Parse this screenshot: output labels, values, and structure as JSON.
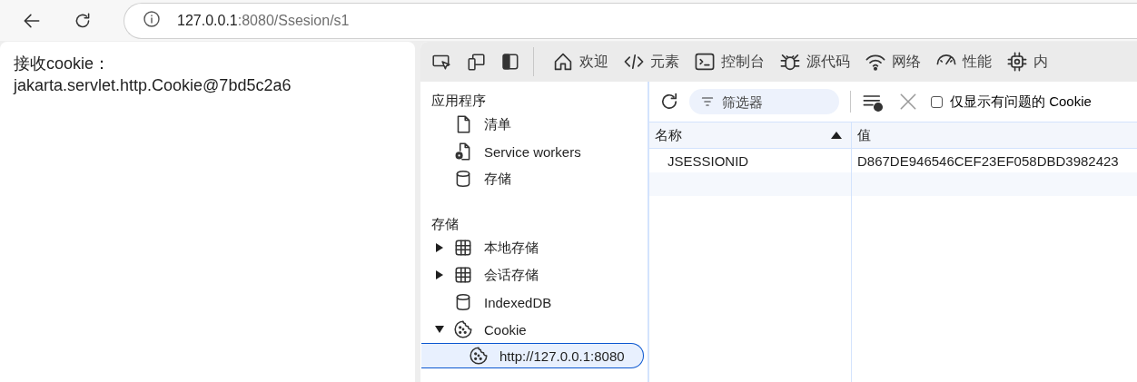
{
  "browser": {
    "address": {
      "host": "127.0.0.1",
      "path": ":8080/Ssesion/s1"
    }
  },
  "page": {
    "lines": [
      "接收cookie：",
      "jakarta.servlet.http.Cookie@7bd5c2a6"
    ]
  },
  "devtools": {
    "tools": [
      {
        "kind": "inspect"
      },
      {
        "kind": "device"
      },
      {
        "kind": "sidebar"
      }
    ],
    "tabs": [
      {
        "kind": "home",
        "label": "欢迎",
        "selected": false
      },
      {
        "kind": "code",
        "label": "元素",
        "selected": false
      },
      {
        "kind": "console",
        "label": "控制台",
        "selected": false
      },
      {
        "kind": "bug",
        "label": "源代码",
        "selected": false
      },
      {
        "kind": "wifi",
        "label": "网络",
        "selected": false
      },
      {
        "kind": "gauge",
        "label": "性能",
        "selected": false
      },
      {
        "kind": "chip",
        "label": "内",
        "selected": false
      }
    ],
    "sidebar": {
      "sections": [
        {
          "title": "应用程序",
          "items": [
            {
              "kind": "file",
              "label": "清单"
            },
            {
              "kind": "gearfile",
              "label": "Service workers"
            },
            {
              "kind": "db",
              "label": "存储"
            }
          ]
        },
        {
          "title": "存储",
          "items": [
            {
              "kind": "grid",
              "label": "本地存储",
              "expanded": false
            },
            {
              "kind": "grid",
              "label": "会话存储",
              "expanded": false
            },
            {
              "kind": "db",
              "label": "IndexedDB"
            },
            {
              "kind": "cookie",
              "label": "Cookie",
              "expanded": true,
              "children": [
                {
                  "kind": "cookie",
                  "label": "http://127.0.0.1:8080",
                  "selected": true
                }
              ]
            }
          ]
        }
      ]
    },
    "cookies": {
      "filter": {
        "placeholder": "筛选器"
      },
      "only_issues": {
        "label": "仅显示有问题的 Cookie",
        "checked": false
      },
      "table": {
        "columns": [
          {
            "label": "名称",
            "sorted": true
          },
          {
            "label": "值"
          }
        ],
        "rows": [
          {
            "name": "JSESSIONID",
            "value": "D867DE946546CEF23EF058DBD3982423",
            "selected": false
          }
        ]
      }
    }
  }
}
